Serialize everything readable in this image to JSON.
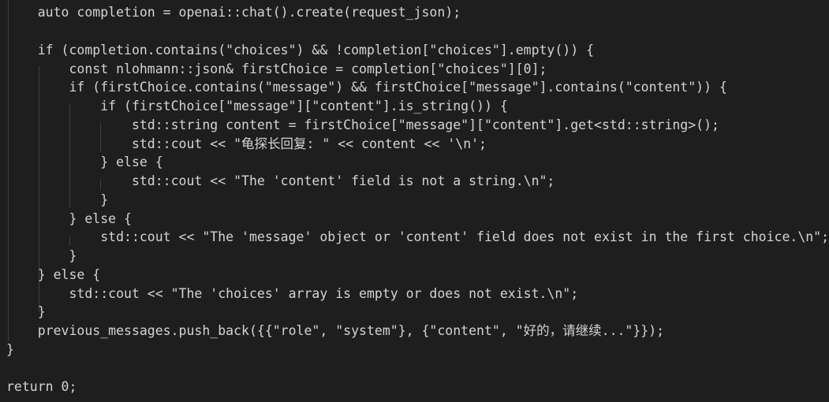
{
  "editor": {
    "lines": [
      "    auto completion = openai::chat().create(request_json);",
      "",
      "    if (completion.contains(\"choices\") && !completion[\"choices\"].empty()) {",
      "        const nlohmann::json& firstChoice = completion[\"choices\"][0];",
      "        if (firstChoice.contains(\"message\") && firstChoice[\"message\"].contains(\"content\")) {",
      "            if (firstChoice[\"message\"][\"content\"].is_string()) {",
      "                std::string content = firstChoice[\"message\"][\"content\"].get<std::string>();",
      "                std::cout << \"龟探长回复: \" << content << '\\n';",
      "            } else {",
      "                std::cout << \"The 'content' field is not a string.\\n\";",
      "            }",
      "        } else {",
      "            std::cout << \"The 'message' object or 'content' field does not exist in the first choice.\\n\";",
      "        }",
      "    } else {",
      "        std::cout << \"The 'choices' array is empty or does not exist.\\n\";",
      "    }",
      "    previous_messages.push_back({{\"role\", \"system\"}, {\"content\", \"好的，请继续...\"}});",
      "}",
      "",
      "return 0;"
    ]
  }
}
